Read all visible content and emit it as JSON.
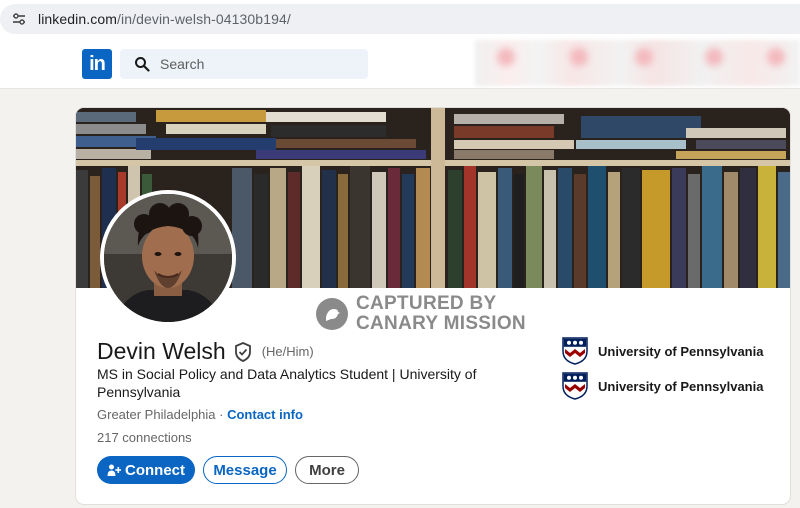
{
  "browser": {
    "url_host": "linkedin.com",
    "url_path": "/in/devin-welsh-04130b194/"
  },
  "nav": {
    "logo": "in",
    "search_placeholder": "Search"
  },
  "profile": {
    "name": "Devin Welsh",
    "pronouns": "(He/Him)",
    "headline": "MS in Social Policy and Data Analytics Student | University of Pennsylvania",
    "location": "Greater Philadelphia",
    "separator": " · ",
    "contact_info": "Contact info",
    "connections": "217 connections"
  },
  "watermark": {
    "line1": "CAPTURED BY",
    "line2": "CANARY MISSION"
  },
  "actions": {
    "connect": "Connect",
    "message": "Message",
    "more": "More"
  },
  "education": [
    {
      "name": "University of Pennsylvania"
    },
    {
      "name": "University of Pennsylvania"
    }
  ],
  "colors": {
    "brand": "#0a66c2",
    "penn_blue": "#011f5b",
    "penn_red": "#990000"
  }
}
